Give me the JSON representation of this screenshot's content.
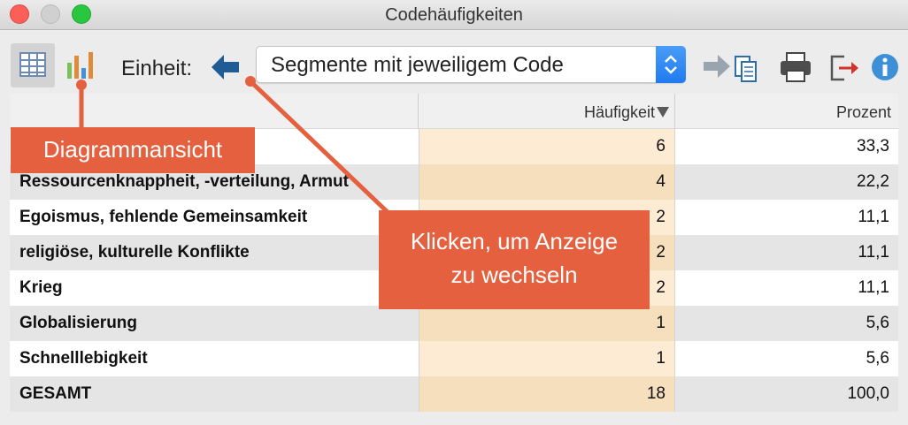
{
  "window": {
    "title": "Codehäufigkeiten"
  },
  "toolbar": {
    "unit_label": "Einheit:",
    "unit_select_value": "Segmente mit jeweiligem Code"
  },
  "table": {
    "headers": [
      "",
      "Häufigkeit",
      "Prozent"
    ],
    "rows": [
      {
        "code": "",
        "count": "6",
        "percent": "33,3"
      },
      {
        "code": "Ressourcenknappheit, -verteilung, Armut",
        "count": "4",
        "percent": "22,2"
      },
      {
        "code": "Egoismus, fehlende Gemeinsamkeit",
        "count": "2",
        "percent": "11,1"
      },
      {
        "code": "religiöse, kulturelle Konflikte",
        "count": "2",
        "percent": "11,1"
      },
      {
        "code": "Krieg",
        "count": "2",
        "percent": "11,1"
      },
      {
        "code": "Globalisierung",
        "count": "1",
        "percent": "5,6"
      },
      {
        "code": "Schnelllebigkeit",
        "count": "1",
        "percent": "5,6"
      },
      {
        "code": "GESAMT",
        "count": "18",
        "percent": "100,0"
      }
    ]
  },
  "callouts": {
    "diagram_view": "Diagrammansicht",
    "click_line1": "Klicken, um Anzeige",
    "click_line2": "zu wechseln"
  },
  "colors": {
    "callout": "#e4603e",
    "count_column": "#fdebd3",
    "accent_blue": "#1f7bf0"
  },
  "icons": {
    "table_view": "table-icon",
    "chart_view": "bar-chart-icon",
    "toggle_unit": "arrow-left-icon",
    "export": "export-to-clipboard-icon",
    "print": "printer-icon",
    "exit": "exit-icon",
    "info": "info-icon"
  }
}
